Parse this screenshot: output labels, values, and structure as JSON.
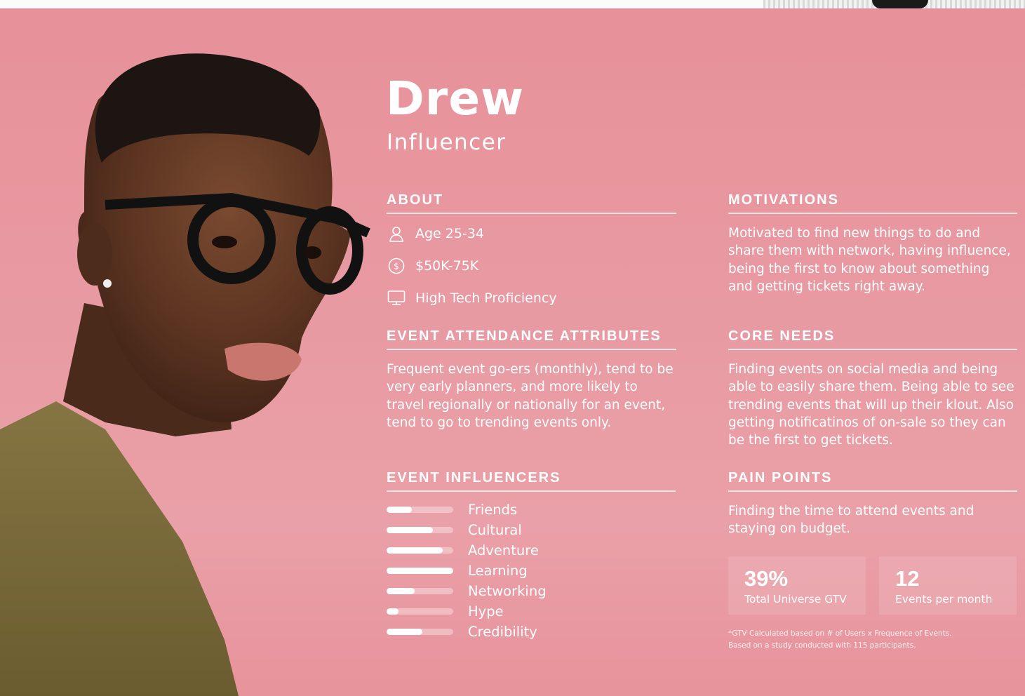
{
  "persona": {
    "name": "Drew",
    "role": "Influencer"
  },
  "about": {
    "title": "ABOUT",
    "items": [
      {
        "icon": "person-icon",
        "text": "Age 25-34"
      },
      {
        "icon": "dollar-icon",
        "text": "$50K-75K"
      },
      {
        "icon": "monitor-icon",
        "text": "High Tech Proficiency"
      }
    ]
  },
  "motivations": {
    "title": "MOTIVATIONS",
    "lines": [
      "Motivated to find new things to do and",
      "share them with network, having influence,",
      "being the first to know about something",
      "and getting tickets right away."
    ]
  },
  "attendance": {
    "title": "EVENT ATTENDANCE ATTRIBUTES",
    "lines": [
      "Frequent event go-ers (monthly), tend to be",
      "very early planners, and more likely to",
      "travel regionally or nationally for an event,",
      "tend to go to trending events only."
    ]
  },
  "core_needs": {
    "title": "CORE NEEDS",
    "lines": [
      "Finding events on social media and being",
      "able to easily share them. Being able to see",
      "trending events that will up their klout. Also",
      "getting notificatinos of on-sale so they can",
      "be the first to get tickets."
    ]
  },
  "influencers": {
    "title": "EVENT INFLUENCERS",
    "items": [
      {
        "label": "Friends",
        "level": 0.38
      },
      {
        "label": "Cultural",
        "level": 0.69
      },
      {
        "label": "Adventure",
        "level": 0.84
      },
      {
        "label": "Learning",
        "level": 1.0
      },
      {
        "label": "Networking",
        "level": 0.42
      },
      {
        "label": "Hype",
        "level": 0.18
      },
      {
        "label": "Credibility",
        "level": 0.54
      }
    ]
  },
  "pain_points": {
    "title": "PAIN POINTS",
    "lines": [
      "Finding the time to attend events and",
      "staying on budget."
    ]
  },
  "stats": [
    {
      "value": "39%",
      "label": "Total Universe GTV"
    },
    {
      "value": "12",
      "label": "Events per month"
    }
  ],
  "footnote": [
    "*GTV Calculated based on # of Users x Frequence of Events.",
    "Based on a study conducted with 115 participants."
  ],
  "colors": {
    "background": "#e89aa2",
    "text": "#ffffff",
    "shirt": "#7a6a3c",
    "skin": "#5a3320",
    "hair": "#1d1512"
  }
}
